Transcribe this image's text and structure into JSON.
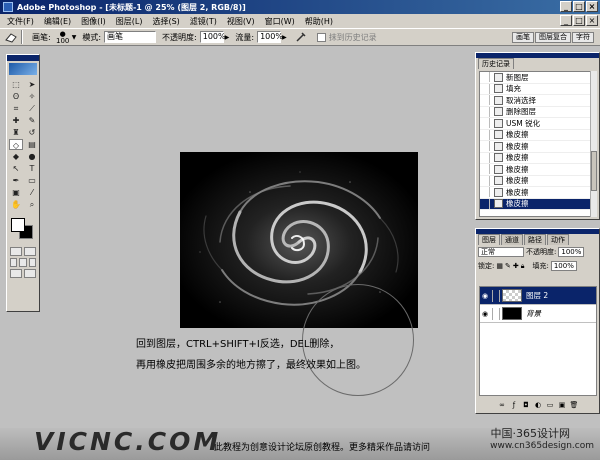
{
  "app": {
    "title": "Adobe Photoshop - [未标题-1 @ 25% (图层 2, RGB/8)]"
  },
  "window_controls": {
    "minimize": "_",
    "maximize": "□",
    "close": "×"
  },
  "menu": {
    "items": [
      "文件(F)",
      "编辑(E)",
      "图像(I)",
      "图层(L)",
      "选择(S)",
      "滤镜(T)",
      "视图(V)",
      "窗口(W)",
      "帮助(H)"
    ]
  },
  "options_bar": {
    "brush_label": "画笔:",
    "brush_size": "100",
    "mode_label": "模式:",
    "mode_value": "画笔",
    "opacity_label": "不透明度:",
    "opacity_value": "100%",
    "flow_label": "流量:",
    "flow_value": "100%",
    "erase_history_label": "抹到历史记录",
    "palette_tabs": [
      "画笔",
      "图层复合",
      "字符"
    ]
  },
  "history_panel": {
    "tab": "历史记录",
    "items": [
      {
        "icon": "doc-icon",
        "label": "新图层"
      },
      {
        "icon": "doc-icon",
        "label": "填充"
      },
      {
        "icon": "doc-icon",
        "label": "取消选择"
      },
      {
        "icon": "doc-icon",
        "label": "删除图层"
      },
      {
        "icon": "doc-icon",
        "label": "USM 锐化"
      },
      {
        "icon": "eraser-icon",
        "label": "橡皮擦"
      },
      {
        "icon": "eraser-icon",
        "label": "橡皮擦"
      },
      {
        "icon": "eraser-icon",
        "label": "橡皮擦"
      },
      {
        "icon": "eraser-icon",
        "label": "橡皮擦"
      },
      {
        "icon": "eraser-icon",
        "label": "橡皮擦"
      },
      {
        "icon": "eraser-icon",
        "label": "橡皮擦"
      },
      {
        "icon": "eraser-icon",
        "label": "橡皮擦"
      }
    ]
  },
  "layers_panel": {
    "tabs": [
      "图层",
      "通道",
      "路径",
      "动作"
    ],
    "blend_mode": "正常",
    "opacity_label": "不透明度:",
    "opacity_value": "100%",
    "lock_label": "锁定:",
    "fill_label": "填充:",
    "fill_value": "100%",
    "layers": [
      {
        "name": "图层 2",
        "thumb": "transparent"
      },
      {
        "name": "背景",
        "thumb": "black"
      }
    ]
  },
  "instructions": {
    "line1": "回到图层，CTRL+SHIFT+I反选，DEL删除，",
    "line2": "再用橡皮把周围多余的地方擦了，最终效果如上图。"
  },
  "footer": {
    "logo": "VICNC.COM",
    "text": "此教程为创意设计论坛原创教程。更多精采作品请访问",
    "watermark_line1": "中国·365设计网",
    "watermark_line2": "www.cn365design.com"
  }
}
